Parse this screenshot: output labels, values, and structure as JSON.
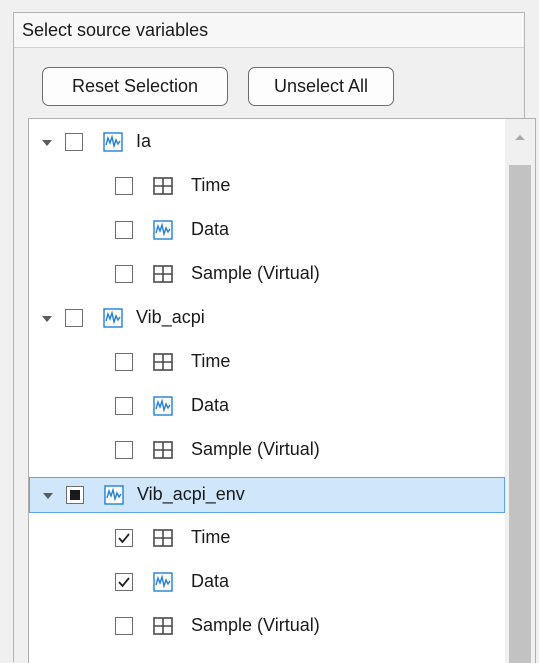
{
  "panel": {
    "title": "Select source variables",
    "reset_label": "Reset Selection",
    "unselect_label": "Unselect All"
  },
  "tree": [
    {
      "kind": "parent",
      "label": "Ia",
      "icon": "signal-icon",
      "state": "unchecked",
      "selected": false
    },
    {
      "kind": "child",
      "label": "Time",
      "icon": "table-icon",
      "state": "unchecked",
      "selected": false
    },
    {
      "kind": "child",
      "label": "Data",
      "icon": "signal-icon",
      "state": "unchecked",
      "selected": false
    },
    {
      "kind": "child",
      "label": "Sample (Virtual)",
      "icon": "table-icon",
      "state": "unchecked",
      "selected": false
    },
    {
      "kind": "parent",
      "label": "Vib_acpi",
      "icon": "signal-icon",
      "state": "unchecked",
      "selected": false
    },
    {
      "kind": "child",
      "label": "Time",
      "icon": "table-icon",
      "state": "unchecked",
      "selected": false
    },
    {
      "kind": "child",
      "label": "Data",
      "icon": "signal-icon",
      "state": "unchecked",
      "selected": false
    },
    {
      "kind": "child",
      "label": "Sample (Virtual)",
      "icon": "table-icon",
      "state": "unchecked",
      "selected": false
    },
    {
      "kind": "parent",
      "label": "Vib_acpi_env",
      "icon": "signal-icon",
      "state": "partial",
      "selected": true
    },
    {
      "kind": "child",
      "label": "Time",
      "icon": "table-icon",
      "state": "checked",
      "selected": false
    },
    {
      "kind": "child",
      "label": "Data",
      "icon": "signal-icon",
      "state": "checked",
      "selected": false
    },
    {
      "kind": "child",
      "label": "Sample (Virtual)",
      "icon": "table-icon",
      "state": "unchecked",
      "selected": false
    }
  ],
  "colors": {
    "selection_bg": "#cfe6fb",
    "selection_border": "#5aa6e8",
    "signal_icon": "#1f7fd6"
  }
}
